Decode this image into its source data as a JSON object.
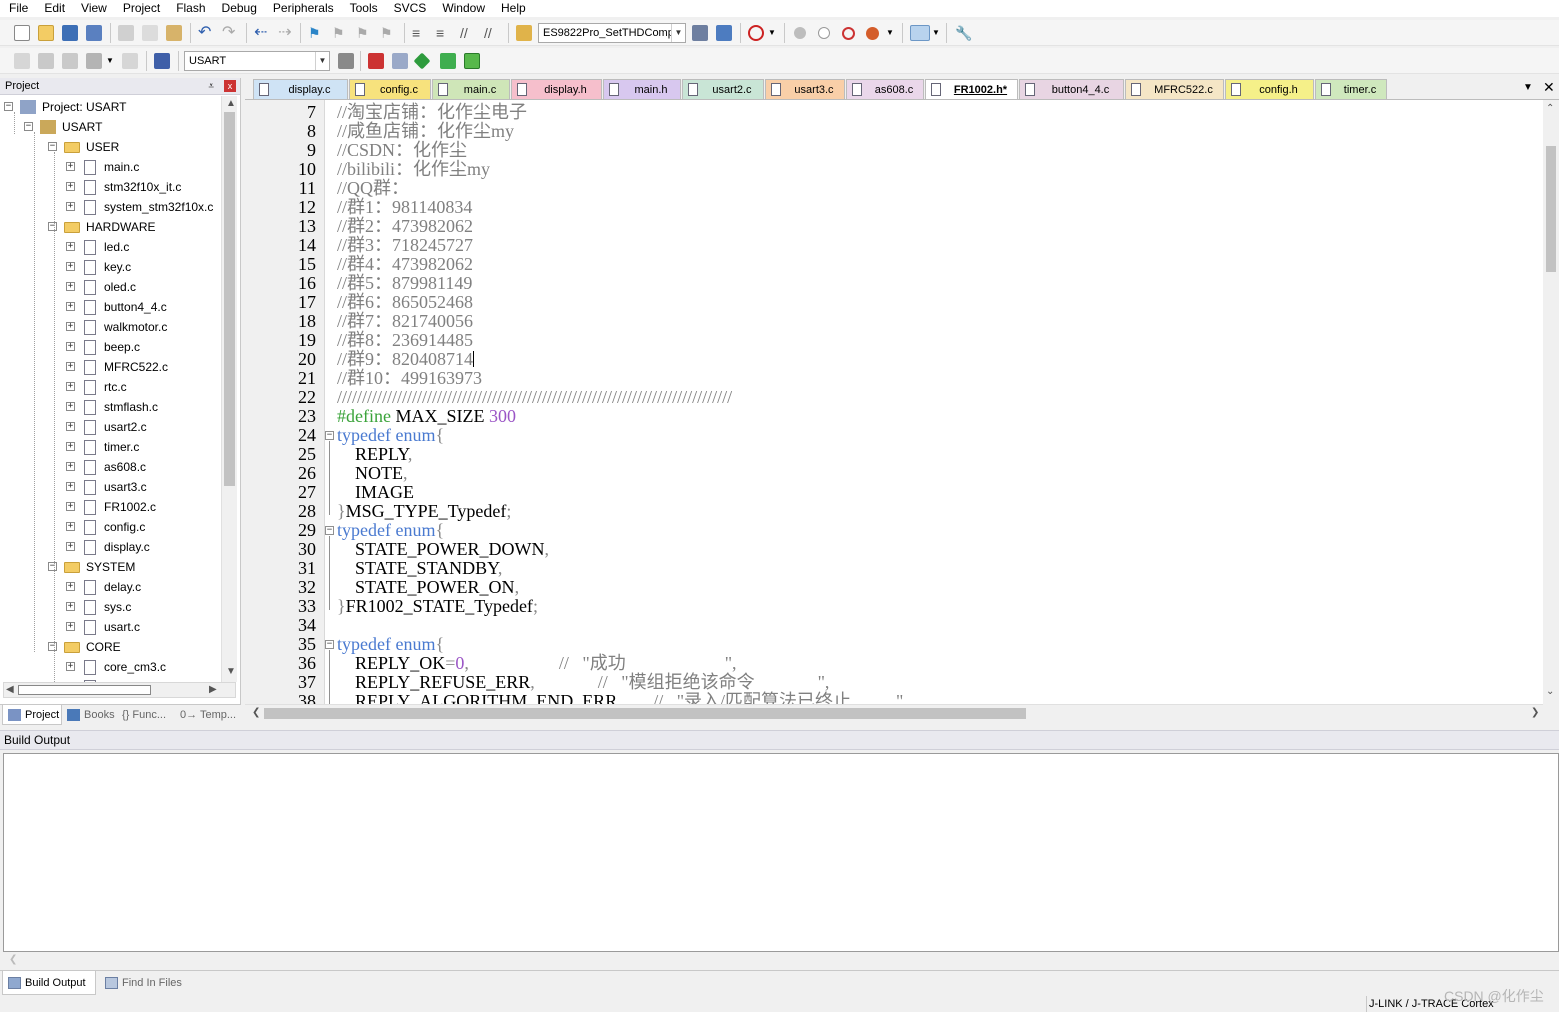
{
  "menu": [
    "File",
    "Edit",
    "View",
    "Project",
    "Flash",
    "Debug",
    "Peripherals",
    "Tools",
    "SVCS",
    "Window",
    "Help"
  ],
  "toolbar1": {
    "target_combo": "ES9822Pro_SetTHDComp"
  },
  "toolbar2": {
    "target_select": "USART"
  },
  "project_panel": {
    "title": "Project",
    "pin": "⩡",
    "close": "x",
    "tree": {
      "root": "Project: USART",
      "target": "USART",
      "groups": [
        {
          "name": "USER",
          "files": [
            "main.c",
            "stm32f10x_it.c",
            "system_stm32f10x.c"
          ]
        },
        {
          "name": "HARDWARE",
          "files": [
            "led.c",
            "key.c",
            "oled.c",
            "button4_4.c",
            "walkmotor.c",
            "beep.c",
            "MFRC522.c",
            "rtc.c",
            "stmflash.c",
            "usart2.c",
            "timer.c",
            "as608.c",
            "usart3.c",
            "FR1002.c",
            "config.c",
            "display.c"
          ]
        },
        {
          "name": "SYSTEM",
          "files": [
            "delay.c",
            "sys.c",
            "usart.c"
          ]
        },
        {
          "name": "CORE",
          "files": [
            "core_cm3.c"
          ]
        }
      ]
    },
    "tabs": [
      {
        "label": "Project",
        "active": true
      },
      {
        "label": "Books",
        "active": false
      },
      {
        "label": "{} Func...",
        "active": false
      },
      {
        "label": "0→ Temp...",
        "active": false
      }
    ]
  },
  "editor_tabs": [
    {
      "label": "display.c",
      "color": "#cfe3f5",
      "active": false
    },
    {
      "label": "config.c",
      "color": "#f7e27d",
      "active": false
    },
    {
      "label": "main.c",
      "color": "#cfe6b8",
      "active": false
    },
    {
      "label": "display.h",
      "color": "#f6bfcc",
      "active": false
    },
    {
      "label": "main.h",
      "color": "#d8c8ef",
      "active": false
    },
    {
      "label": "usart2.c",
      "color": "#c9e5d6",
      "active": false
    },
    {
      "label": "usart3.c",
      "color": "#f9cfa8",
      "active": false
    },
    {
      "label": "as608.c",
      "color": "#ead7ea",
      "active": false
    },
    {
      "label": "FR1002.h*",
      "color": "#ffffff",
      "active": true
    },
    {
      "label": "button4_4.c",
      "color": "#e8d5e3",
      "active": false
    },
    {
      "label": "MFRC522.c",
      "color": "#f5e6c6",
      "active": false
    },
    {
      "label": "config.h",
      "color": "#f5f089",
      "active": false
    },
    {
      "label": "timer.c",
      "color": "#cfe8bd",
      "active": false
    }
  ],
  "editor": {
    "line_numbers": [
      "7",
      "8",
      "9",
      "10",
      "11",
      "12",
      "13",
      "14",
      "15",
      "16",
      "17",
      "18",
      "19",
      "20",
      "21",
      "22",
      "23",
      "24",
      "25",
      "26",
      "27",
      "28",
      "29",
      "30",
      "31",
      "32",
      "33",
      "34",
      "35",
      "36",
      "37",
      "38"
    ],
    "lines": [
      [
        {
          "t": "//淘宝店铺：化作尘电子",
          "c": "cm"
        }
      ],
      [
        {
          "t": "//咸鱼店铺：化作尘my",
          "c": "cm"
        }
      ],
      [
        {
          "t": "//CSDN：化作尘",
          "c": "cm"
        }
      ],
      [
        {
          "t": "//bilibili：化作尘my",
          "c": "cm"
        }
      ],
      [
        {
          "t": "//QQ群：",
          "c": "cm"
        }
      ],
      [
        {
          "t": "//群1：981140834",
          "c": "cm"
        }
      ],
      [
        {
          "t": "//群2：473982062",
          "c": "cm"
        }
      ],
      [
        {
          "t": "//群3：718245727",
          "c": "cm"
        }
      ],
      [
        {
          "t": "//群4：473982062",
          "c": "cm"
        }
      ],
      [
        {
          "t": "//群5：879981149",
          "c": "cm"
        }
      ],
      [
        {
          "t": "//群6：865052468",
          "c": "cm"
        }
      ],
      [
        {
          "t": "//群7：821740056",
          "c": "cm"
        }
      ],
      [
        {
          "t": "//群8：236914485",
          "c": "cm"
        }
      ],
      [
        {
          "t": "//群9：820408714",
          "c": "cm"
        },
        {
          "t": "",
          "c": "caret"
        }
      ],
      [
        {
          "t": "//群10：499163973",
          "c": "cm"
        }
      ],
      [
        {
          "t": "///////////////////////////////////////////////////////////////////////////////",
          "c": "cm"
        }
      ],
      [
        {
          "t": "#define",
          "c": "pp"
        },
        {
          "t": " MAX_SIZE ",
          "c": ""
        },
        {
          "t": "300",
          "c": "nm"
        }
      ],
      [
        {
          "t": "typedef",
          "c": "kw"
        },
        {
          "t": " ",
          "c": ""
        },
        {
          "t": "enum",
          "c": "kw"
        },
        {
          "t": "{",
          "c": "pc"
        }
      ],
      [
        {
          "t": "    REPLY",
          "c": ""
        },
        {
          "t": ",",
          "c": "pc"
        }
      ],
      [
        {
          "t": "    NOTE",
          "c": ""
        },
        {
          "t": ",",
          "c": "pc"
        }
      ],
      [
        {
          "t": "    IMAGE",
          "c": ""
        }
      ],
      [
        {
          "t": "}",
          "c": "pc"
        },
        {
          "t": "MSG_TYPE_Typedef",
          "c": ""
        },
        {
          "t": ";",
          "c": "pc"
        }
      ],
      [
        {
          "t": "typedef",
          "c": "kw"
        },
        {
          "t": " ",
          "c": ""
        },
        {
          "t": "enum",
          "c": "kw"
        },
        {
          "t": "{",
          "c": "pc"
        }
      ],
      [
        {
          "t": "    STATE_POWER_DOWN",
          "c": ""
        },
        {
          "t": ",",
          "c": "pc"
        }
      ],
      [
        {
          "t": "    STATE_STANDBY",
          "c": ""
        },
        {
          "t": ",",
          "c": "pc"
        }
      ],
      [
        {
          "t": "    STATE_POWER_ON",
          "c": ""
        },
        {
          "t": ",",
          "c": "pc"
        }
      ],
      [
        {
          "t": "}",
          "c": "pc"
        },
        {
          "t": "FR1002_STATE_Typedef",
          "c": ""
        },
        {
          "t": ";",
          "c": "pc"
        }
      ],
      [
        {
          "t": "",
          "c": ""
        }
      ],
      [
        {
          "t": "typedef",
          "c": "kw"
        },
        {
          "t": " ",
          "c": ""
        },
        {
          "t": "enum",
          "c": "kw"
        },
        {
          "t": "{",
          "c": "pc"
        }
      ],
      [
        {
          "t": "    REPLY_OK",
          "c": ""
        },
        {
          "t": "=",
          "c": "pc"
        },
        {
          "t": "0",
          "c": "nm"
        },
        {
          "t": ",",
          "c": "pc"
        },
        {
          "t": "                    //   \"成功                      \",",
          "c": "cm"
        }
      ],
      [
        {
          "t": "    REPLY_REFUSE_ERR",
          "c": ""
        },
        {
          "t": ",",
          "c": "pc"
        },
        {
          "t": "              //   \"模组拒绝该命令              \",",
          "c": "cm"
        }
      ],
      [
        {
          "t": "    REPLY_ALGORITHM_END_ERR",
          "c": ""
        },
        {
          "t": ",",
          "c": "pc"
        },
        {
          "t": "       //   \"录入/匹配算法已终止          \"",
          "c": "cm"
        }
      ]
    ]
  },
  "build_output": {
    "title": "Build Output",
    "tabs": [
      {
        "label": "Build Output",
        "active": true
      },
      {
        "label": "Find In Files",
        "active": false
      }
    ]
  },
  "statusbar": {
    "debugger": "J-LINK / J-TRACE Cortex"
  },
  "watermark": "CSDN @化作尘"
}
